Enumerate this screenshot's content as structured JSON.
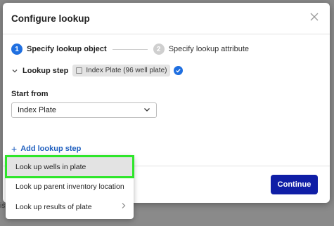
{
  "modal": {
    "title": "Configure lookup",
    "close_icon": "close-icon"
  },
  "steps": [
    {
      "number": "1",
      "label": "Specify lookup object",
      "active": true
    },
    {
      "number": "2",
      "label": "Specify lookup attribute",
      "active": false
    }
  ],
  "lookup_step": {
    "label": "Lookup step",
    "chip_text": "Index Plate (96 well plate)",
    "status_icon": "check-circle-icon"
  },
  "start_from": {
    "label": "Start from",
    "selected": "Index Plate"
  },
  "add_lookup_step_label": "Add lookup step",
  "continue_label": "Continue",
  "dropdown": {
    "items": [
      {
        "label": "Look up wells in plate",
        "highlighted": true
      },
      {
        "label": "Look up parent inventory location",
        "highlighted": false
      },
      {
        "label": "Look up results of plate",
        "highlighted": false,
        "has_submenu": true
      }
    ]
  },
  "colors": {
    "accent": "#1f6fe0",
    "primary_button": "#0f1ea6",
    "highlight_outline": "#2ee62a"
  }
}
